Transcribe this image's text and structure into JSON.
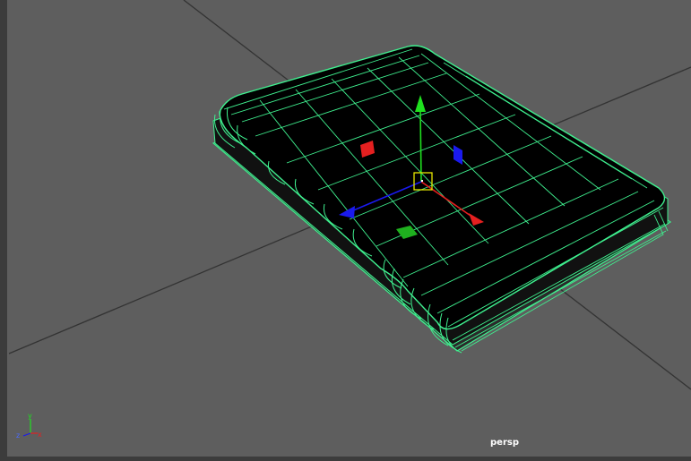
{
  "viewport": {
    "camera_label": "persp",
    "background_color": "#5e5e5e",
    "grid_color": "#333333",
    "wire_color": "#3ff08f"
  },
  "object": {
    "name": "",
    "selected": true,
    "shape": "book-mesh-wireframe"
  },
  "manipulator": {
    "type": "move-tool",
    "axis_colors": {
      "x": "#e52020",
      "y": "#1fe01f",
      "z": "#1a1aee",
      "center": "#e8e800"
    }
  },
  "axis_indicator": {
    "labels": {
      "x": "x",
      "y": "y",
      "z": "z"
    }
  }
}
